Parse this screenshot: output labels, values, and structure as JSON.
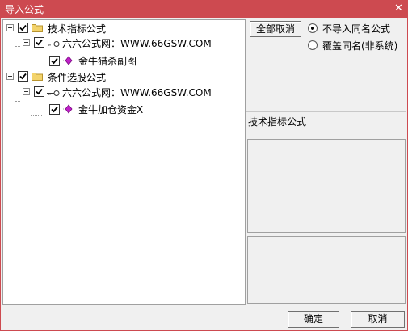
{
  "window": {
    "title": "导入公式",
    "close_glyph": "✕"
  },
  "tree": {
    "groups": [
      {
        "label": "技术指标公式",
        "checked": true,
        "source": {
          "label": "六六公式网：WWW.66GSW.COM",
          "checked": true
        },
        "item": {
          "label": "金牛猎杀副图",
          "checked": true
        }
      },
      {
        "label": "条件选股公式",
        "checked": true,
        "source": {
          "label": "六六公式网：WWW.66GSW.COM",
          "checked": true
        },
        "item": {
          "label": "金牛加仓资金X",
          "checked": true
        }
      }
    ]
  },
  "options": {
    "cancel_all_label": "全部取消",
    "radio_no_import": "不导入同名公式",
    "radio_overwrite": "覆盖同名(非系统)",
    "selected": "no_import"
  },
  "preview": {
    "formula_type_label": "技术指标公式"
  },
  "footer": {
    "ok_label": "确定",
    "cancel_label": "取消"
  },
  "colors": {
    "titlebar": "#cd4a50",
    "gem": "#c020c8",
    "folder": "#f3d36b"
  }
}
